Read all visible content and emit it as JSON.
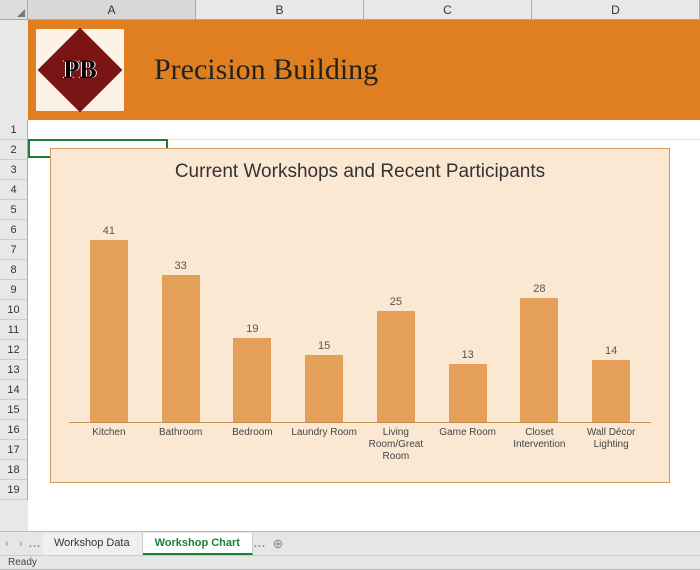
{
  "columns": [
    "A",
    "B",
    "C",
    "D"
  ],
  "rows": [
    "1",
    "2",
    "3",
    "4",
    "5",
    "6",
    "7",
    "8",
    "9",
    "10",
    "11",
    "12",
    "13",
    "14",
    "15",
    "16",
    "17",
    "18",
    "19"
  ],
  "banner": {
    "logo_text": "PB",
    "title": "Precision Building"
  },
  "chart_data": {
    "type": "bar",
    "title": "Current Workshops and Recent Participants",
    "categories": [
      "Kitchen",
      "Bathroom",
      "Bedroom",
      "Laundry Room",
      "Living Room/Great Room",
      "Game Room",
      "Closet Intervention",
      "Wall Décor Lighting"
    ],
    "values": [
      41,
      33,
      19,
      15,
      25,
      13,
      28,
      14
    ],
    "xlabel": "",
    "ylabel": "",
    "ylim": [
      0,
      45
    ]
  },
  "tabs": {
    "items": [
      "Workshop Data",
      "Workshop Chart"
    ],
    "active_index": 1,
    "ellipsis": "..."
  },
  "status": {
    "text": "Ready"
  },
  "icons": {
    "nav_prev": "‹",
    "nav_next": "›",
    "nav_menu": "...",
    "add_sheet": "⊕"
  }
}
